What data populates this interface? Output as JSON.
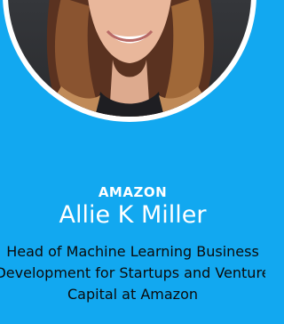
{
  "speaker": {
    "company": "AMAZON",
    "name": "Allie K Miller",
    "title": "Head of Machine Learning Business Development for Startups and Venture Capital at Amazon"
  },
  "colors": {
    "background": "#12a8f0",
    "avatar_ring": "#ffffff",
    "text_light": "#ffffff",
    "text_dark": "#0b0b0b"
  }
}
